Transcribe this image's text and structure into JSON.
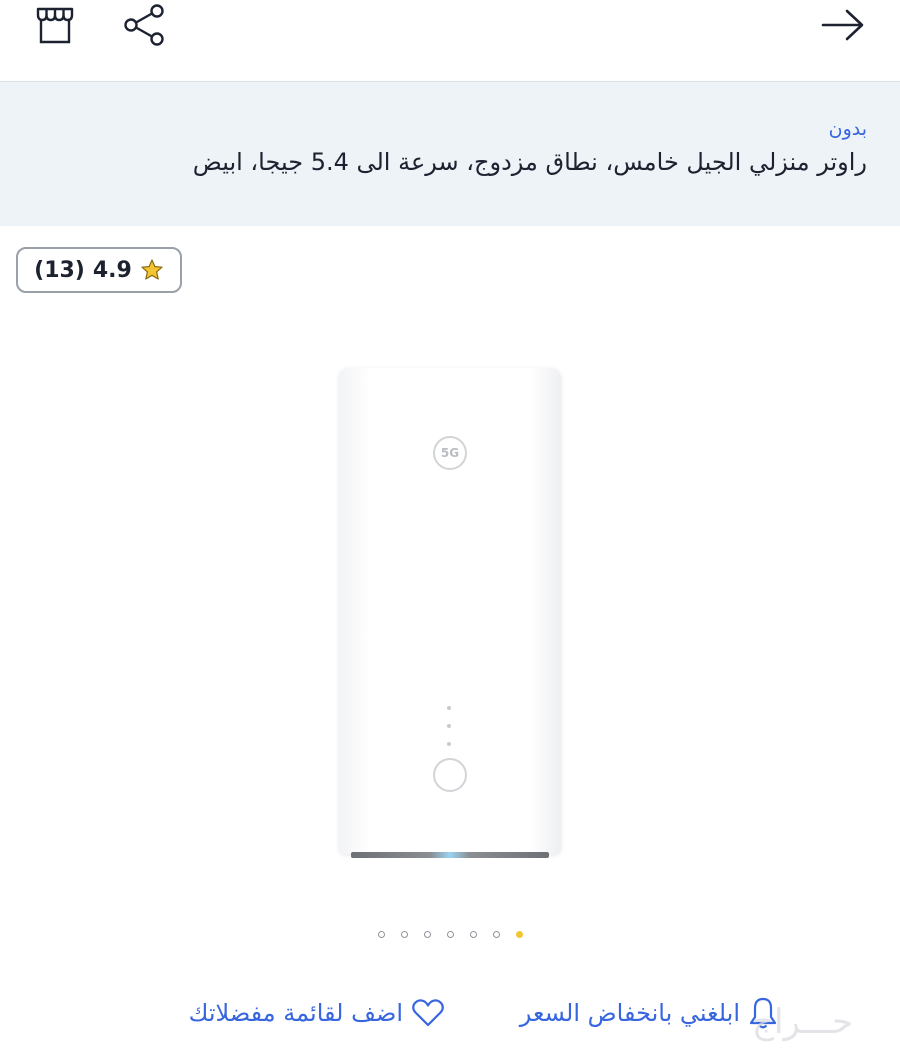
{
  "header": {
    "back_icon": "arrow-right-icon",
    "share_icon": "share-icon",
    "store_icon": "storefront-icon"
  },
  "product": {
    "brand": "بدون",
    "title": "راوتر منزلي الجيل خامس، نطاق مزدوج، سرعة الى 5.4 جيجا، ابيض"
  },
  "rating": {
    "value": "4.9",
    "count": "(13)",
    "star_color": "#f4c533"
  },
  "gallery": {
    "image_label": "5G",
    "dot_count": 7,
    "active_dot": 7
  },
  "actions": {
    "price_alert_label": "ابلغني بانخفاض السعر",
    "wishlist_label": "اضف لقائمة مفضلاتك"
  },
  "colors": {
    "accent": "#3866df",
    "info_background": "#eef3f8"
  }
}
